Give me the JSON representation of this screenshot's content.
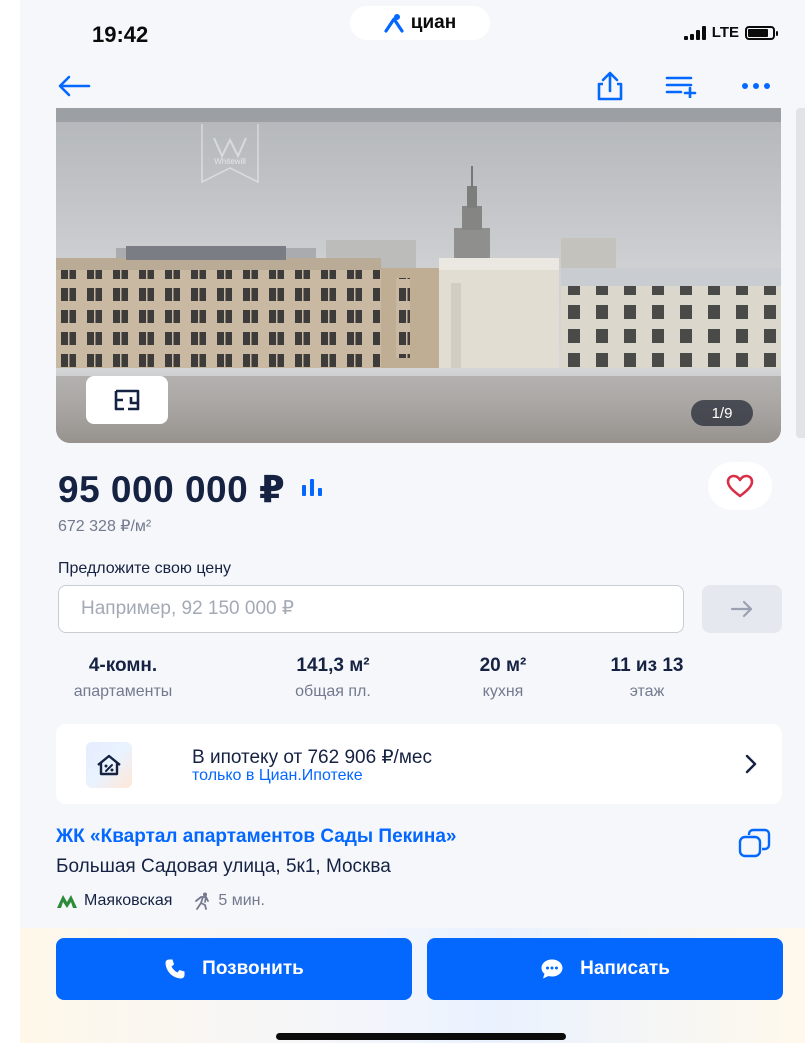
{
  "status_bar": {
    "time": "19:42",
    "island_brand": "циан",
    "network": "LTE",
    "battery_level": 0.85
  },
  "nav": {
    "back_icon": "arrow-left-icon",
    "share_icon": "share-icon",
    "compare_icon": "add-to-list-icon",
    "more_icon": "more-dots-icon"
  },
  "gallery": {
    "counter": "1/9",
    "watermark": "Whitewill"
  },
  "price": {
    "total": "95 000 000 ₽",
    "per_meter": "672 328 ₽/м²"
  },
  "offer": {
    "label": "Предложите свою цену",
    "placeholder": "Например, 92 150 000 ₽",
    "value": ""
  },
  "facts": [
    {
      "value": "4-комн.",
      "label": "апартаменты"
    },
    {
      "value": "141,3 м²",
      "label": "общая пл."
    },
    {
      "value": "20 м²",
      "label": "кухня"
    },
    {
      "value": "11 из 13",
      "label": "этаж"
    }
  ],
  "mortgage": {
    "title": "В ипотеку от 762 906 ₽/мес",
    "subtitle": "только в Циан.Ипотеке"
  },
  "complex": {
    "name": "ЖК «Квартал апартаментов Сады Пекина»",
    "address": "Большая Садовая улица, 5к1, Москва",
    "metro": "Маяковская",
    "walk": "5 мин."
  },
  "actions": {
    "call": "Позвонить",
    "write": "Написать"
  },
  "colors": {
    "accent": "#0468ff",
    "heart": "#d9304a",
    "metro": "#2e8b3a",
    "text": "#152242",
    "muted": "#737a8e"
  }
}
